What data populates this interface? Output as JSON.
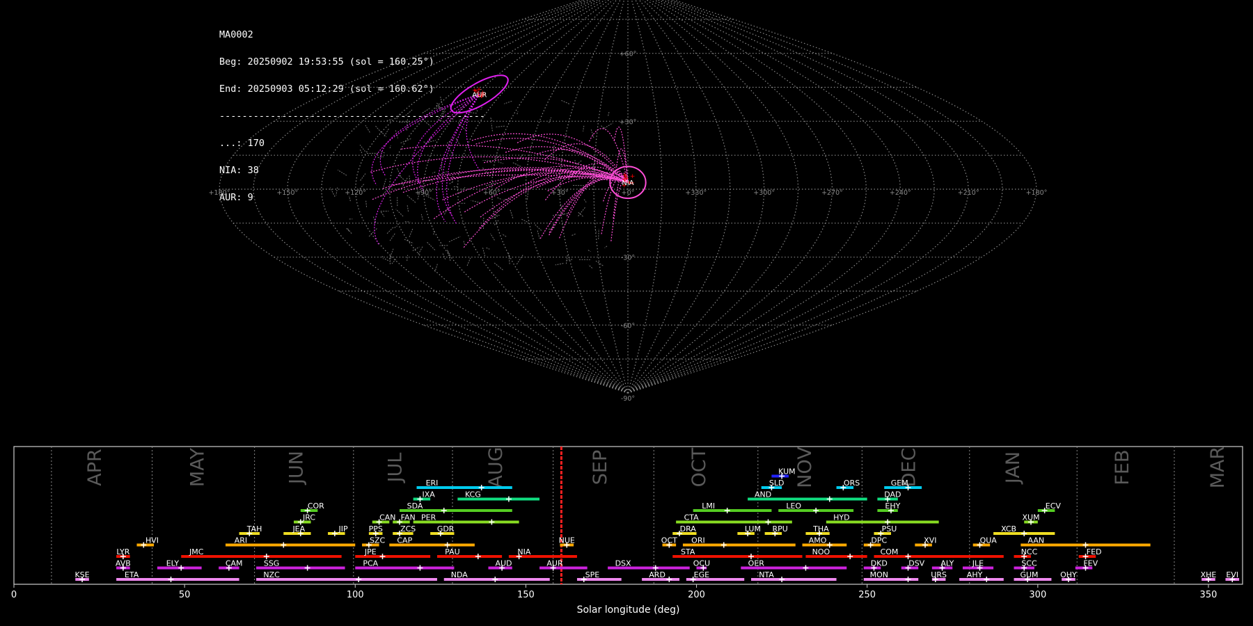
{
  "info": {
    "camera": "MA0002",
    "begin": "Beg: 20250902 19:53:55 (sol = 160.25°)",
    "end": "End: 20250903 05:12:29 (sol = 160.62°)",
    "separator": "-----------------------------------------------",
    "counts": [
      "...: 170",
      "NIA: 38",
      "AUR: 9"
    ]
  },
  "colors": {
    "background": "#000000",
    "grid": "#8a8a8a",
    "sporadic": "#9a9a9a",
    "nia": "#ff4fd8",
    "aur": "#e020f0",
    "marker": "#ff0000"
  },
  "chart_data": [
    {
      "type": "scatter",
      "projection": "sinusoidal",
      "grid": true,
      "lat_labels": [
        "+90°",
        "+60°",
        "+30°",
        "-30°",
        "-60°",
        "-90°"
      ],
      "lon_labels": [
        "+180°",
        "+150°",
        "+120°",
        "+90°",
        "+60°",
        "+30°",
        "+0°",
        "+330°",
        "+300°",
        "+270°",
        "+240°",
        "+210°",
        "+180°"
      ],
      "radiants": [
        {
          "code": "NIA",
          "lon": 0,
          "lat": 3,
          "radius_deg": 6,
          "color": "#ff4fd8"
        },
        {
          "code": "AUR",
          "lon": 88,
          "lat": 42,
          "radius_deg": 6,
          "color": "#e020f0"
        }
      ],
      "meteor_counts": {
        "sporadic": 170,
        "NIA": 38,
        "AUR": 9
      }
    },
    {
      "type": "bar",
      "orientation": "horizontal",
      "xlabel": "Solar longitude (deg)",
      "xlim": [
        0,
        360
      ],
      "xticks": [
        0,
        50,
        100,
        150,
        200,
        250,
        300,
        350
      ],
      "current_sol": 160.4,
      "months": [
        {
          "label": "APR",
          "start": 11,
          "center": 24
        },
        {
          "label": "MAY",
          "start": 40.5,
          "center": 54
        },
        {
          "label": "JUN",
          "start": 70.5,
          "center": 83
        },
        {
          "label": "JUL",
          "start": 99.5,
          "center": 112
        },
        {
          "label": "AUG",
          "start": 128.5,
          "center": 141.5
        },
        {
          "label": "SEP",
          "start": 158,
          "center": 172
        },
        {
          "label": "OCT",
          "start": 187.5,
          "center": 201
        },
        {
          "label": "NOV",
          "start": 218,
          "center": 232
        },
        {
          "label": "DEC",
          "start": 248.5,
          "center": 262.5
        },
        {
          "label": "JAN",
          "start": 280,
          "center": 293
        },
        {
          "label": "FEB",
          "start": 311.5,
          "center": 325
        },
        {
          "label": "MAR",
          "start": 340,
          "center": 353
        }
      ],
      "showers": [
        {
          "code": "KUM",
          "start": 222,
          "end": 227,
          "peak": 225,
          "row": 9,
          "color": "#2222ff"
        },
        {
          "code": "ERI",
          "start": 118,
          "end": 146,
          "peak": 137,
          "row": 8,
          "color": "#00ccee"
        },
        {
          "code": "SLD",
          "start": 219,
          "end": 225,
          "peak": 222,
          "row": 8,
          "color": "#00ccee"
        },
        {
          "code": "ORS",
          "start": 241,
          "end": 246,
          "peak": 243,
          "row": 8,
          "color": "#00ccee"
        },
        {
          "code": "GEM",
          "start": 255,
          "end": 266,
          "peak": 262,
          "row": 8,
          "color": "#00ccee"
        },
        {
          "code": "IXA",
          "start": 117,
          "end": 122,
          "peak": 119,
          "row": 7,
          "color": "#10dd80"
        },
        {
          "code": "KCG",
          "start": 130,
          "end": 154,
          "peak": 145,
          "row": 7,
          "color": "#10dd80"
        },
        {
          "code": "AND",
          "start": 215,
          "end": 250,
          "peak": 239,
          "row": 7,
          "color": "#10dd80"
        },
        {
          "code": "DAD",
          "start": 253,
          "end": 259,
          "peak": 256,
          "row": 7,
          "color": "#10dd80"
        },
        {
          "code": "COR",
          "start": 84,
          "end": 89,
          "peak": 86,
          "row": 6,
          "color": "#55cc22"
        },
        {
          "code": "SDA",
          "start": 113,
          "end": 146,
          "peak": 126,
          "row": 6,
          "color": "#55cc22"
        },
        {
          "code": "LMI",
          "start": 199,
          "end": 222,
          "peak": 209,
          "row": 6,
          "color": "#55cc22"
        },
        {
          "code": "LEO",
          "start": 224,
          "end": 246,
          "peak": 235,
          "row": 6,
          "color": "#55cc22"
        },
        {
          "code": "EHY",
          "start": 253,
          "end": 259,
          "peak": 257,
          "row": 6,
          "color": "#55cc22"
        },
        {
          "code": "ECV",
          "start": 300,
          "end": 305,
          "peak": 302,
          "row": 6,
          "color": "#55cc22"
        },
        {
          "code": "JRC",
          "start": 82,
          "end": 87,
          "peak": 84,
          "row": 5,
          "color": "#88dd22"
        },
        {
          "code": "CAN",
          "start": 105,
          "end": 110,
          "peak": 107,
          "row": 5,
          "color": "#88dd22"
        },
        {
          "code": "FAN",
          "start": 111,
          "end": 116,
          "peak": 113,
          "row": 5,
          "color": "#88dd22"
        },
        {
          "code": "PER",
          "start": 117,
          "end": 148,
          "peak": 140,
          "row": 5,
          "color": "#88dd22"
        },
        {
          "code": "CTA",
          "start": 194,
          "end": 228,
          "peak": 221,
          "row": 5,
          "color": "#88dd22"
        },
        {
          "code": "HYD",
          "start": 238,
          "end": 271,
          "peak": 256,
          "row": 5,
          "color": "#88dd22"
        },
        {
          "code": "XUM",
          "start": 296,
          "end": 300,
          "peak": 298,
          "row": 5,
          "color": "#88dd22"
        },
        {
          "code": "TAH",
          "start": 66,
          "end": 72,
          "peak": 69,
          "row": 4,
          "color": "#eedd22"
        },
        {
          "code": "JEA",
          "start": 79,
          "end": 87,
          "peak": 84,
          "row": 4,
          "color": "#eedd22"
        },
        {
          "code": "JIP",
          "start": 92,
          "end": 97,
          "peak": 94,
          "row": 4,
          "color": "#eedd22"
        },
        {
          "code": "PPS",
          "start": 104,
          "end": 108,
          "peak": 106,
          "row": 4,
          "color": "#eedd22"
        },
        {
          "code": "ZCS",
          "start": 111,
          "end": 117,
          "peak": 113,
          "row": 4,
          "color": "#eedd22"
        },
        {
          "code": "GDR",
          "start": 122,
          "end": 129,
          "peak": 125,
          "row": 4,
          "color": "#eedd22"
        },
        {
          "code": "DRA",
          "start": 193,
          "end": 200,
          "peak": 195,
          "row": 4,
          "color": "#eedd22"
        },
        {
          "code": "LUM",
          "start": 212,
          "end": 217,
          "peak": 215,
          "row": 4,
          "color": "#eedd22"
        },
        {
          "code": "RPU",
          "start": 220,
          "end": 225,
          "peak": 223,
          "row": 4,
          "color": "#eedd22"
        },
        {
          "code": "THA",
          "start": 232,
          "end": 239,
          "peak": 236,
          "row": 4,
          "color": "#eedd22"
        },
        {
          "code": "PSU",
          "start": 252,
          "end": 257,
          "peak": 254,
          "row": 4,
          "color": "#eedd22"
        },
        {
          "code": "XCB",
          "start": 287,
          "end": 305,
          "peak": 296,
          "row": 4,
          "color": "#eedd22"
        },
        {
          "code": "HVI",
          "start": 36,
          "end": 41,
          "peak": 38,
          "row": 3,
          "color": "#ffaa00"
        },
        {
          "code": "ARI",
          "start": 62,
          "end": 100,
          "peak": 79,
          "row": 3,
          "color": "#ffaa00"
        },
        {
          "code": "SZC",
          "start": 102,
          "end": 107,
          "peak": 104,
          "row": 3,
          "color": "#ffaa00"
        },
        {
          "code": "CAP",
          "start": 110,
          "end": 135,
          "peak": 127,
          "row": 3,
          "color": "#ffaa00"
        },
        {
          "code": "NUE",
          "start": 160,
          "end": 164,
          "peak": 162,
          "row": 3,
          "color": "#ffaa00"
        },
        {
          "code": "OCT",
          "start": 190,
          "end": 194,
          "peak": 192,
          "row": 3,
          "color": "#ffaa00"
        },
        {
          "code": "ORI",
          "start": 196,
          "end": 229,
          "peak": 208,
          "row": 3,
          "color": "#ffaa00"
        },
        {
          "code": "AMO",
          "start": 231,
          "end": 244,
          "peak": 239,
          "row": 3,
          "color": "#ffaa00"
        },
        {
          "code": "DPC",
          "start": 249,
          "end": 254,
          "peak": 251,
          "row": 3,
          "color": "#ffaa00"
        },
        {
          "code": "XVI",
          "start": 264,
          "end": 269,
          "peak": 267,
          "row": 3,
          "color": "#ffaa00"
        },
        {
          "code": "QUA",
          "start": 281,
          "end": 286,
          "peak": 283,
          "row": 3,
          "color": "#ffaa00"
        },
        {
          "code": "AAN",
          "start": 295,
          "end": 333,
          "peak": 314,
          "row": 3,
          "color": "#ffaa00"
        },
        {
          "code": "LYR",
          "start": 30,
          "end": 34,
          "peak": 32,
          "row": 2,
          "color": "#ee1100"
        },
        {
          "code": "JMC",
          "start": 49,
          "end": 96,
          "peak": 74,
          "row": 2,
          "color": "#ee1100"
        },
        {
          "code": "JPE",
          "start": 100,
          "end": 122,
          "peak": 108,
          "row": 2,
          "color": "#ee1100"
        },
        {
          "code": "PAU",
          "start": 124,
          "end": 143,
          "peak": 136,
          "row": 2,
          "color": "#ee1100"
        },
        {
          "code": "NIA",
          "start": 145,
          "end": 165,
          "peak": 148,
          "row": 2,
          "color": "#ee1100"
        },
        {
          "code": "STA",
          "start": 193,
          "end": 231,
          "peak": 216,
          "row": 2,
          "color": "#ee1100"
        },
        {
          "code": "NOO",
          "start": 232,
          "end": 250,
          "peak": 245,
          "row": 2,
          "color": "#ee1100"
        },
        {
          "code": "COM",
          "start": 252,
          "end": 290,
          "peak": 262,
          "row": 2,
          "color": "#ee1100"
        },
        {
          "code": "NCC",
          "start": 293,
          "end": 298,
          "peak": 296,
          "row": 2,
          "color": "#ee1100"
        },
        {
          "code": "FED",
          "start": 312,
          "end": 317,
          "peak": 314,
          "row": 2,
          "color": "#ee1100"
        },
        {
          "code": "AVB",
          "start": 30,
          "end": 34,
          "peak": 32,
          "row": 1,
          "color": "#cc22dd"
        },
        {
          "code": "ELY",
          "start": 42,
          "end": 55,
          "peak": 49,
          "row": 1,
          "color": "#cc22dd"
        },
        {
          "code": "CAM",
          "start": 60,
          "end": 66,
          "peak": 63,
          "row": 1,
          "color": "#cc22dd"
        },
        {
          "code": "SSG",
          "start": 71,
          "end": 97,
          "peak": 86,
          "row": 1,
          "color": "#cc22dd"
        },
        {
          "code": "PCA",
          "start": 100,
          "end": 129,
          "peak": 119,
          "row": 1,
          "color": "#cc22dd"
        },
        {
          "code": "AUD",
          "start": 139,
          "end": 146,
          "peak": 143,
          "row": 1,
          "color": "#cc22dd"
        },
        {
          "code": "AUR",
          "start": 154,
          "end": 168,
          "peak": 158,
          "row": 1,
          "color": "#cc22dd"
        },
        {
          "code": "DSX",
          "start": 174,
          "end": 198,
          "peak": 188,
          "row": 1,
          "color": "#cc22dd"
        },
        {
          "code": "OCU",
          "start": 200,
          "end": 203,
          "peak": 202,
          "row": 1,
          "color": "#cc22dd"
        },
        {
          "code": "OER",
          "start": 213,
          "end": 244,
          "peak": 232,
          "row": 1,
          "color": "#cc22dd"
        },
        {
          "code": "DKD",
          "start": 249,
          "end": 254,
          "peak": 252,
          "row": 1,
          "color": "#cc22dd"
        },
        {
          "code": "DSV",
          "start": 260,
          "end": 265,
          "peak": 262,
          "row": 1,
          "color": "#cc22dd"
        },
        {
          "code": "ALY",
          "start": 269,
          "end": 275,
          "peak": 272,
          "row": 1,
          "color": "#cc22dd"
        },
        {
          "code": "JLE",
          "start": 278,
          "end": 287,
          "peak": 283,
          "row": 1,
          "color": "#cc22dd"
        },
        {
          "code": "SCC",
          "start": 293,
          "end": 299,
          "peak": 296,
          "row": 1,
          "color": "#cc22dd"
        },
        {
          "code": "FEV",
          "start": 311,
          "end": 316,
          "peak": 314,
          "row": 1,
          "color": "#cc22dd"
        },
        {
          "code": "KSE",
          "start": 18,
          "end": 22,
          "peak": 20,
          "row": 0,
          "color": "#ee88ee"
        },
        {
          "code": "ETA",
          "start": 30,
          "end": 66,
          "peak": 46,
          "row": 0,
          "color": "#ee88ee"
        },
        {
          "code": "NZC",
          "start": 71,
          "end": 124,
          "peak": 101,
          "row": 0,
          "color": "#ee88ee"
        },
        {
          "code": "NDA",
          "start": 126,
          "end": 157,
          "peak": 141,
          "row": 0,
          "color": "#ee88ee"
        },
        {
          "code": "SPE",
          "start": 165,
          "end": 178,
          "peak": 167,
          "row": 0,
          "color": "#ee88ee"
        },
        {
          "code": "ARD",
          "start": 184,
          "end": 195,
          "peak": 192,
          "row": 0,
          "color": "#ee88ee"
        },
        {
          "code": "EGE",
          "start": 197,
          "end": 214,
          "peak": 199,
          "row": 0,
          "color": "#ee88ee"
        },
        {
          "code": "NTA",
          "start": 216,
          "end": 241,
          "peak": 225,
          "row": 0,
          "color": "#ee88ee"
        },
        {
          "code": "MON",
          "start": 249,
          "end": 265,
          "peak": 262,
          "row": 0,
          "color": "#ee88ee"
        },
        {
          "code": "URS",
          "start": 269,
          "end": 273,
          "peak": 270,
          "row": 0,
          "color": "#ee88ee"
        },
        {
          "code": "AHY",
          "start": 277,
          "end": 290,
          "peak": 285,
          "row": 0,
          "color": "#ee88ee"
        },
        {
          "code": "GUM",
          "start": 293,
          "end": 304,
          "peak": 297,
          "row": 0,
          "color": "#ee88ee"
        },
        {
          "code": "OHY",
          "start": 307,
          "end": 311,
          "peak": 309,
          "row": 0,
          "color": "#ee88ee"
        },
        {
          "code": "XHE",
          "start": 348,
          "end": 352,
          "peak": 350,
          "row": 0,
          "color": "#ee88ee"
        },
        {
          "code": "EVI",
          "start": 355,
          "end": 359,
          "peak": 357,
          "row": 0,
          "color": "#ee88ee"
        }
      ]
    }
  ]
}
